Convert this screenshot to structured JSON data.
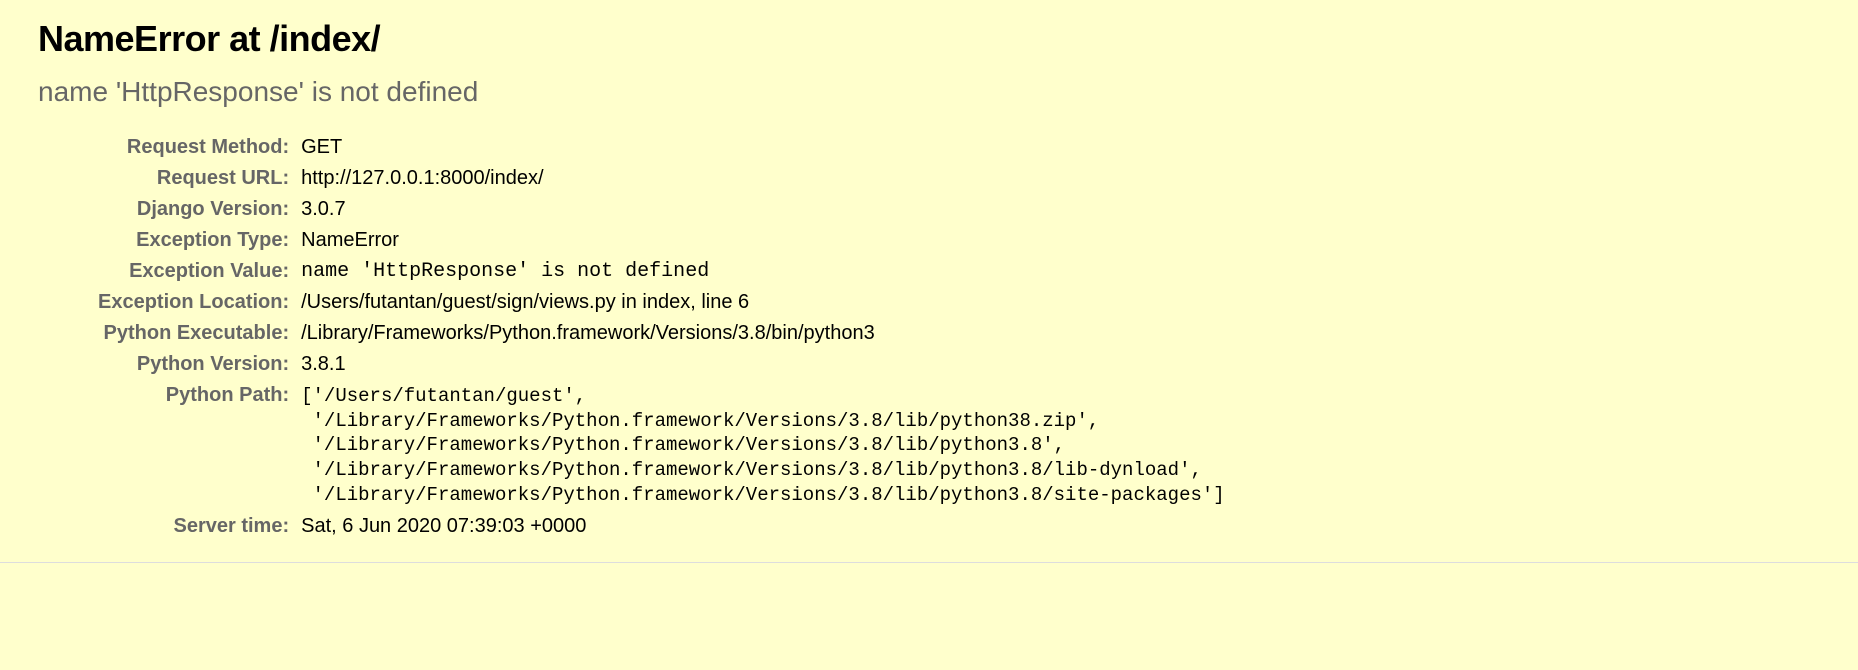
{
  "title": "NameError at /index/",
  "subtitle": "name 'HttpResponse' is not defined",
  "labels": {
    "request_method": "Request Method:",
    "request_url": "Request URL:",
    "django_version": "Django Version:",
    "exception_type": "Exception Type:",
    "exception_value": "Exception Value:",
    "exception_location": "Exception Location:",
    "python_executable": "Python Executable:",
    "python_version": "Python Version:",
    "python_path": "Python Path:",
    "server_time": "Server time:"
  },
  "values": {
    "request_method": "GET",
    "request_url": "http://127.0.0.1:8000/index/",
    "django_version": "3.0.7",
    "exception_type": "NameError",
    "exception_value": "name 'HttpResponse' is not defined",
    "exception_location": "/Users/futantan/guest/sign/views.py in index, line 6",
    "python_executable": "/Library/Frameworks/Python.framework/Versions/3.8/bin/python3",
    "python_version": "3.8.1",
    "python_path": "['/Users/futantan/guest',\n '/Library/Frameworks/Python.framework/Versions/3.8/lib/python38.zip',\n '/Library/Frameworks/Python.framework/Versions/3.8/lib/python3.8',\n '/Library/Frameworks/Python.framework/Versions/3.8/lib/python3.8/lib-dynload',\n '/Library/Frameworks/Python.framework/Versions/3.8/lib/python3.8/site-packages']",
    "server_time": "Sat, 6 Jun 2020 07:39:03 +0000"
  }
}
